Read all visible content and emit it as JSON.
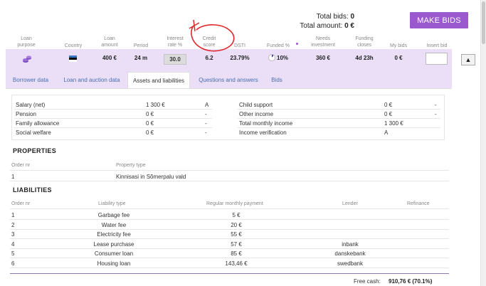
{
  "totals": {
    "bids_label": "Total bids:",
    "bids_value": "0",
    "amount_label": "Total amount:",
    "amount_value": "0 €"
  },
  "make_bids_label": "MAKE BIDS",
  "columns": [
    {
      "line1": "Loan",
      "line2": "purpose"
    },
    {
      "line1": "Country",
      "line2": ""
    },
    {
      "line1": "Loan",
      "line2": "amount"
    },
    {
      "line1": "Period",
      "line2": ""
    },
    {
      "line1": "Interest",
      "line2": "rate %"
    },
    {
      "line1": "Credit",
      "line2": "score"
    },
    {
      "line1": "DSTI",
      "line2": ""
    },
    {
      "line1": "Funded %",
      "line2": ""
    },
    {
      "line1": "Needs",
      "line2": "investment"
    },
    {
      "line1": "Funding",
      "line2": "closes"
    },
    {
      "line1": "My bids",
      "line2": ""
    },
    {
      "line1": "Insert bid",
      "line2": ""
    }
  ],
  "loan": {
    "purpose_icon": "coins-icon",
    "country_flag": "estonia-flag",
    "amount": "400 €",
    "period": "24 m",
    "interest_rate": "30.0",
    "credit_score": "6.2",
    "dsti": "23.79%",
    "funded": "10%",
    "funded_fraction": 0.1,
    "needs_investment": "360 €",
    "funding_closes": "4d 23h",
    "my_bids": "0 €",
    "collapse_icon": "chevron-up-icon"
  },
  "tabs": [
    {
      "label": "Borrower data"
    },
    {
      "label": "Loan and auction data"
    },
    {
      "label": "Assets and liabilities"
    },
    {
      "label": "Questions and answers"
    },
    {
      "label": "Bids"
    }
  ],
  "income_left": [
    {
      "label": "Salary (net)",
      "amount": "1 300 €",
      "flag": "A"
    },
    {
      "label": "Pension",
      "amount": "0 €",
      "flag": "-"
    },
    {
      "label": "Family allowance",
      "amount": "0 €",
      "flag": "-"
    },
    {
      "label": "Social welfare",
      "amount": "0 €",
      "flag": "-"
    }
  ],
  "income_right": [
    {
      "label": "Child support",
      "amount": "0 €",
      "flag": "-"
    },
    {
      "label": "Other income",
      "amount": "0 €",
      "flag": "-"
    },
    {
      "label": "Total monthly income",
      "amount": "1 300 €",
      "flag": ""
    },
    {
      "label": "Income verification",
      "amount": "A",
      "flag": ""
    }
  ],
  "properties": {
    "title": "PROPERTIES",
    "headers": [
      "Order nr",
      "Property type"
    ],
    "rows": [
      {
        "nr": "1",
        "type": "Kinnisasi in Sõmerpalu vald"
      }
    ]
  },
  "liabilities": {
    "title": "LIABILITIES",
    "headers": [
      "Order nr",
      "Liability type",
      "Regular monthly payment",
      "Lender",
      "Refinance"
    ],
    "rows": [
      {
        "nr": "1",
        "type": "Garbage fee",
        "payment": "5 €",
        "lender": ""
      },
      {
        "nr": "2",
        "type": "Water fee",
        "payment": "20 €",
        "lender": ""
      },
      {
        "nr": "3",
        "type": "Electricity fee",
        "payment": "55 €",
        "lender": ""
      },
      {
        "nr": "4",
        "type": "Lease purchase",
        "payment": "57 €",
        "lender": "inbank"
      },
      {
        "nr": "5",
        "type": "Consumer loan",
        "payment": "85 €",
        "lender": "danskebank"
      },
      {
        "nr": "6",
        "type": "Housing loan",
        "payment": "143,46 €",
        "lender": "swedbank"
      }
    ]
  },
  "free_cash": {
    "label": "Free cash:",
    "value": "910,76 € (70.1%)"
  },
  "colors": {
    "accent": "#9b59d0",
    "row_bg": "#eadff7",
    "link": "#4a6fb0",
    "annotation": "#e0282c"
  }
}
